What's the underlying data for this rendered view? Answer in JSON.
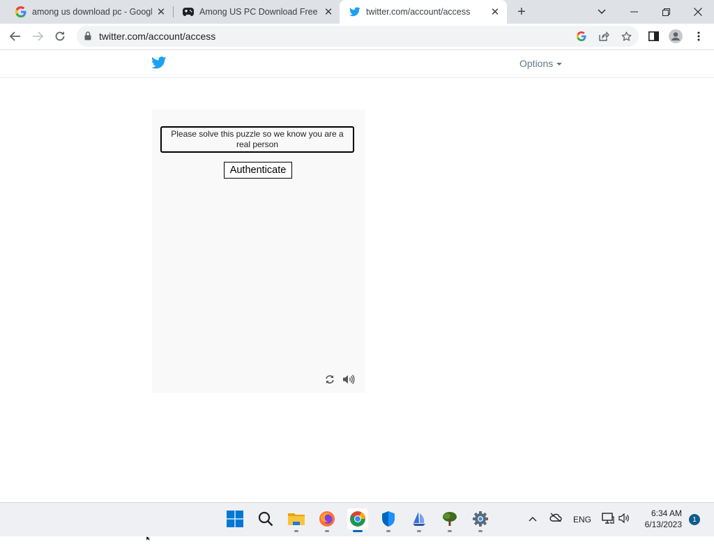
{
  "browser": {
    "tabs": [
      {
        "title": "among us download pc - Google",
        "icon": "google-icon"
      },
      {
        "title": "Among US PC Download Free Ga",
        "icon": "gamepad-icon"
      },
      {
        "title": "twitter.com/account/access",
        "icon": "twitter-icon",
        "active": true
      }
    ],
    "url": "twitter.com/account/access"
  },
  "page": {
    "options_label": "Options",
    "puzzle": {
      "prompt": "Please solve this puzzle so we know you are a real person",
      "button_label": "Authenticate"
    }
  },
  "taskbar": {
    "apps": [
      "windows-start",
      "search",
      "file-explorer",
      "firefox",
      "chrome",
      "windows-security",
      "sailboat-app",
      "tree-app",
      "settings"
    ],
    "active_app": "chrome",
    "language": "ENG",
    "time": "6:34 AM",
    "date": "6/13/2023",
    "notification_count": "1"
  },
  "colors": {
    "twitter_blue": "#1da1f2",
    "tabstrip": "#dee1e6",
    "taskbar": "#eef0f3"
  }
}
